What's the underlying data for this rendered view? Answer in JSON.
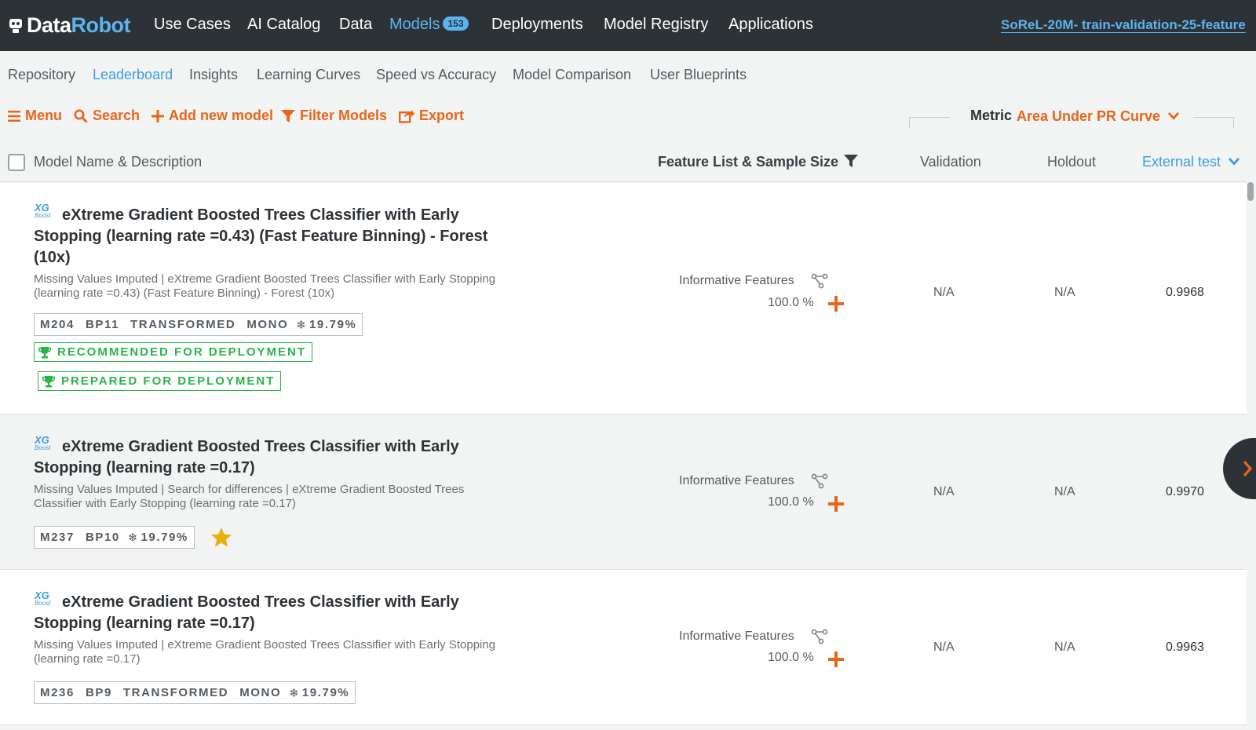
{
  "brand": {
    "data": "Data",
    "robot": "Robot"
  },
  "nav": {
    "items": [
      "Use Cases",
      "AI Catalog",
      "Data",
      "Models",
      "Deployments",
      "Model Registry",
      "Applications"
    ],
    "models_count": "153",
    "project": "SoReL-20M- train-validation-25-feature"
  },
  "subtabs": [
    "Repository",
    "Leaderboard",
    "Insights",
    "Learning Curves",
    "Speed vs Accuracy",
    "Model Comparison",
    "User Blueprints"
  ],
  "toolbar": {
    "menu": "Menu",
    "search": "Search",
    "add": "Add new model",
    "filter": "Filter Models",
    "export": "Export",
    "metric_label": "Metric",
    "metric_value": "Area Under PR Curve"
  },
  "table": {
    "headers": {
      "model": "Model Name & Description",
      "feature": "Feature List & Sample Size",
      "validation": "Validation",
      "holdout": "Holdout",
      "external": "External test"
    },
    "rows": [
      {
        "badge_top": "XG",
        "badge_bottom": "Boost",
        "title": "eXtreme Gradient Boosted Trees Classifier with Early Stopping (learning rate =0.43) (Fast Feature Binning) - Forest (10x)",
        "desc": "Missing Values Imputed | eXtreme Gradient Boosted Trees Classifier with Early Stopping (learning rate =0.43) (Fast Feature Binning) - Forest (10x)",
        "tags": [
          "M204",
          "BP11",
          "TRANSFORMED",
          "MONO"
        ],
        "sample_pct": "19.79%",
        "deploy1": "RECOMMENDED FOR DEPLOYMENT",
        "deploy2": "PREPARED FOR DEPLOYMENT",
        "feature_list": "Informative Features",
        "feature_pct": "100.0 %",
        "validation": "N/A",
        "holdout": "N/A",
        "external": "0.9968"
      },
      {
        "badge_top": "XG",
        "badge_bottom": "Boost",
        "title": "eXtreme Gradient Boosted Trees Classifier with Early Stopping (learning rate =0.17)",
        "desc": "Missing Values Imputed | Search for differences | eXtreme Gradient Boosted Trees Classifier with Early Stopping (learning rate =0.17)",
        "tags": [
          "M237",
          "BP10"
        ],
        "sample_pct": "19.79%",
        "starred": true,
        "feature_list": "Informative Features",
        "feature_pct": "100.0 %",
        "validation": "N/A",
        "holdout": "N/A",
        "external": "0.9970"
      },
      {
        "badge_top": "XG",
        "badge_bottom": "Boost",
        "title": "eXtreme Gradient Boosted Trees Classifier with Early Stopping (learning rate =0.17)",
        "desc": "Missing Values Imputed | eXtreme Gradient Boosted Trees Classifier with Early Stopping (learning rate =0.17)",
        "tags": [
          "M236",
          "BP9",
          "TRANSFORMED",
          "MONO"
        ],
        "sample_pct": "19.79%",
        "feature_list": "Informative Features",
        "feature_pct": "100.0 %",
        "validation": "N/A",
        "holdout": "N/A",
        "external": "0.9963"
      }
    ]
  },
  "colors": {
    "accent": "#e8661c",
    "link": "#3d9ee0",
    "nav_bg": "#2d3237",
    "success": "#2ab34a",
    "star": "#e8b10a"
  },
  "icons": [
    "robot-logo-icon",
    "hamburger-icon",
    "search-icon",
    "plus-icon",
    "funnel-icon",
    "export-icon",
    "chevron-down-icon",
    "trophy-icon",
    "snowflake-icon",
    "star-icon",
    "feature-tree-icon",
    "chevron-right-icon"
  ]
}
